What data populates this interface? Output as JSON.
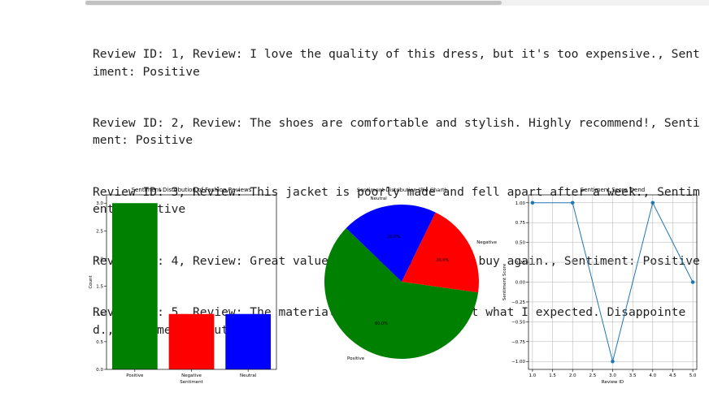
{
  "output_lines": [
    "Review ID: 1, Review: I love the quality of this dress, but it's too expensive., Sentiment: Positive",
    "Review ID: 2, Review: The shoes are comfortable and stylish. Highly recommend!, Sentiment: Positive",
    "Review ID: 3, Review: This jacket is poorly made and fell apart after a week., Sentiment: Negative",
    "Review ID: 4, Review: Great value for the price. Will buy again., Sentiment: Positive",
    "Review ID: 5, Review: The material of the shirt is not what I expected. Disappointed., Sentiment: Neutral"
  ],
  "chart_data": [
    {
      "type": "bar",
      "title": "Sentiment Distribution of Fashion Reviews",
      "xlabel": "Sentiment",
      "ylabel": "Count",
      "categories": [
        "Positive",
        "Negative",
        "Neutral"
      ],
      "values": [
        3,
        1,
        1
      ],
      "colors": [
        "#008000",
        "#ff0000",
        "#0000ff"
      ],
      "ylim": [
        0,
        3.15
      ],
      "yticks": [
        "0.0",
        "0.5",
        "1.0",
        "1.5",
        "2.0",
        "2.5",
        "3.0"
      ],
      "grid": false
    },
    {
      "type": "pie",
      "title": "Sentiment Distribution (Pie Chart)",
      "labels": [
        "Positive",
        "Negative",
        "Neutral"
      ],
      "values": [
        60.0,
        20.0,
        20.0
      ],
      "pct_labels": [
        "60.0%",
        "20.0%",
        "20.0%"
      ],
      "colors": [
        "#008000",
        "#ff0000",
        "#0000ff"
      ]
    },
    {
      "type": "line",
      "title": "Sentiment Score Trend",
      "xlabel": "Review ID",
      "ylabel": "Sentiment Score",
      "x": [
        1,
        2,
        3,
        4,
        5
      ],
      "y": [
        1.0,
        1.0,
        -1.0,
        1.0,
        0.0
      ],
      "color": "#1f77b4",
      "xlim": [
        0.9,
        5.1
      ],
      "ylim": [
        -1.1,
        1.1
      ],
      "xticks": [
        "1.0",
        "1.5",
        "2.0",
        "2.5",
        "3.0",
        "3.5",
        "4.0",
        "4.5",
        "5.0"
      ],
      "yticks": [
        "-1.00",
        "-0.75",
        "-0.50",
        "-0.25",
        "0.00",
        "0.25",
        "0.50",
        "0.75",
        "1.00"
      ],
      "grid": true
    }
  ]
}
